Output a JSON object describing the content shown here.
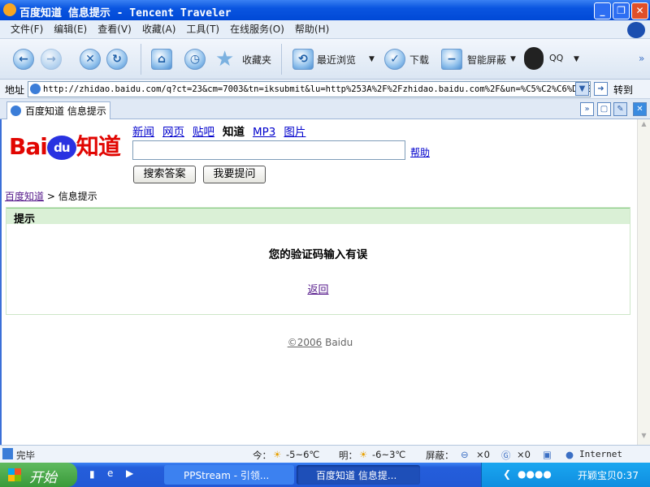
{
  "window": {
    "title": "百度知道 信息提示 - Tencent Traveler"
  },
  "menu": [
    "文件(F)",
    "编辑(E)",
    "查看(V)",
    "收藏(A)",
    "工具(T)",
    "在线服务(O)",
    "帮助(H)"
  ],
  "toolbar": {
    "favorites": "收藏夹",
    "recent": "最近浏览",
    "download": "下载",
    "block": "智能屏蔽",
    "qq": "QQ",
    "more": "»"
  },
  "address": {
    "label": "地址",
    "url": "http://zhidao.baidu.com/q?ct=23&cm=7003&tn=iksubmit&lu=http%253A%2F%2Fzhidao.baidu.com%2F&un=%C5%C2%C6%DE%B5%",
    "go": "转到"
  },
  "tab": {
    "label": "百度知道 信息提示"
  },
  "page": {
    "logo": "Baidu知道",
    "nav": [
      "新闻",
      "网页",
      "贴吧",
      "知道",
      "MP3",
      "图片"
    ],
    "search_value": "",
    "help": "帮助",
    "search_button": "搜索答案",
    "ask_button": "我要提问",
    "breadcrumb_home": "百度知道",
    "breadcrumb_current": "> 信息提示",
    "box_title": "提示",
    "message": "您的验证码输入有误",
    "back": "返回",
    "copyright_link": "©2006",
    "copyright_text": " Baidu"
  },
  "status": {
    "text": "完毕",
    "today": "今：",
    "today_temp": "-5~6℃",
    "tomorrow": "明：",
    "tomorrow_temp": "-6~3℃",
    "blocked": "屏蔽：",
    "count1": "×0",
    "count2": "×0",
    "zone": "Internet"
  },
  "taskbar": {
    "start": "开始",
    "task1": "PPStream - 引领...",
    "task2": "百度知道 信息提...",
    "clock": "开颖宝贝0:37"
  },
  "colors": {
    "accent_green": "#daf0d6",
    "logo_red": "#e10602",
    "logo_blue": "#2932e1"
  }
}
